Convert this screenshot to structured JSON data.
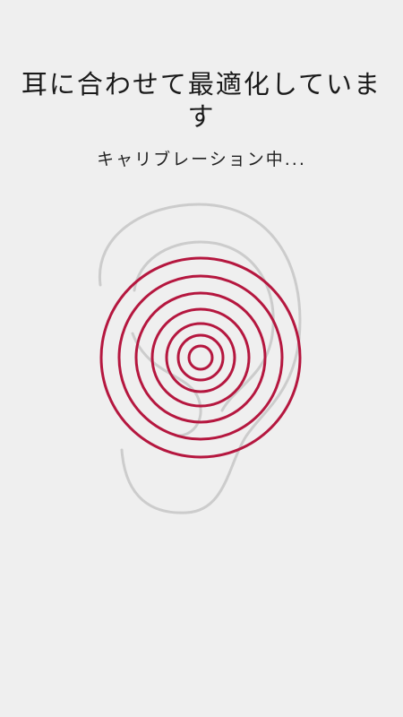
{
  "calibration": {
    "title": "耳に合わせて最適化しています",
    "status": "キャリブレーション中..."
  },
  "colors": {
    "background": "#efefef",
    "ring": "#b5173f",
    "ear_outline": "#cccccc",
    "text": "#1a1a1a"
  },
  "icons": {
    "ear": "ear-outline-icon",
    "rings": "sound-rings-icon"
  }
}
